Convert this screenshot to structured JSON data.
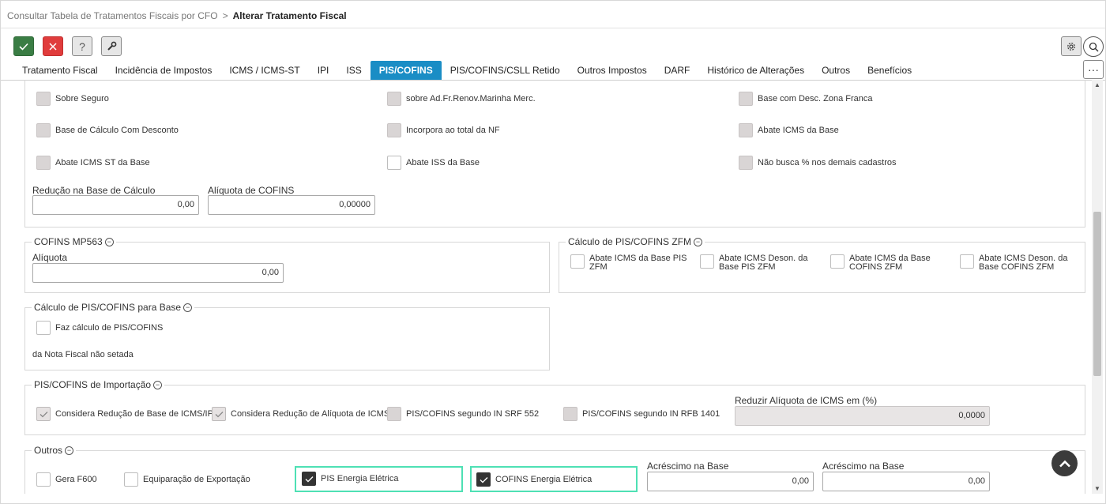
{
  "breadcrumb": {
    "parent": "Consultar Tabela de Tratamentos Fiscais por CFO",
    "separator": ">",
    "current": "Alterar Tratamento Fiscal"
  },
  "toolbar": {
    "confirm_color": "#3a7d44",
    "cancel_color": "#e03c3c",
    "help_glyph": "?"
  },
  "tabs": [
    "Tratamento Fiscal",
    "Incidência de Impostos",
    "ICMS / ICMS-ST",
    "IPI",
    "ISS",
    "PIS/COFINS",
    "PIS/COFINS/CSLL Retido",
    "Outros Impostos",
    "DARF",
    "Histórico de Alterações",
    "Outros",
    "Benefícios"
  ],
  "active_tab": "PIS/COFINS",
  "accent_color": "#1a8dc5",
  "top_checks": [
    "Sobre Seguro",
    "sobre Ad.Fr.Renov.Marinha Merc.",
    "Base com Desc. Zona Franca",
    "Base de Cálculo Com Desconto",
    "Incorpora ao total da NF",
    "Abate ICMS da Base",
    "Abate ICMS ST da Base",
    "Abate ISS da Base",
    "Não busca % nos demais cadastros"
  ],
  "reducao": {
    "label": "Redução na Base de Cálculo",
    "value": "0,00"
  },
  "aliquota_cofins": {
    "label": "Alíquota de COFINS",
    "value": "0,00000"
  },
  "mp563": {
    "title": "COFINS MP563",
    "aliquota_label": "Alíquota",
    "aliquota_value": "0,00"
  },
  "zfm": {
    "title": "Cálculo de PIS/COFINS ZFM",
    "checks": [
      "Abate ICMS da Base PIS ZFM",
      "Abate ICMS Deson. da Base PIS ZFM",
      "Abate ICMS da Base COFINS ZFM",
      "Abate ICMS Deson. da Base COFINS ZFM"
    ]
  },
  "calc_base": {
    "title": "Cálculo de PIS/COFINS para Base",
    "check": "Faz cálculo de PIS/COFINS",
    "note": "da Nota Fiscal não setada"
  },
  "importacao": {
    "title": "PIS/COFINS de Importação",
    "checks": [
      "Considera Redução de Base de ICMS/IPI",
      "Considera Redução de Alíquota de ICMS",
      "PIS/COFINS segundo IN SRF 552",
      "PIS/COFINS segundo IN RFB 1401"
    ],
    "reduzir_label": "Reduzir Alíquota de ICMS em (%)",
    "reduzir_value": "0,0000"
  },
  "outros": {
    "title": "Outros",
    "checks": [
      "Gera F600",
      "Equiparação de Exportação",
      "PIS Energia Elétrica",
      "COFINS Energia Elétrica"
    ],
    "acrescimo1_label": "Acréscimo na Base",
    "acrescimo1_value": "0,00",
    "acrescimo2_label": "Acréscimo na Base",
    "acrescimo2_value": "0,00"
  },
  "minus_glyph": "−"
}
